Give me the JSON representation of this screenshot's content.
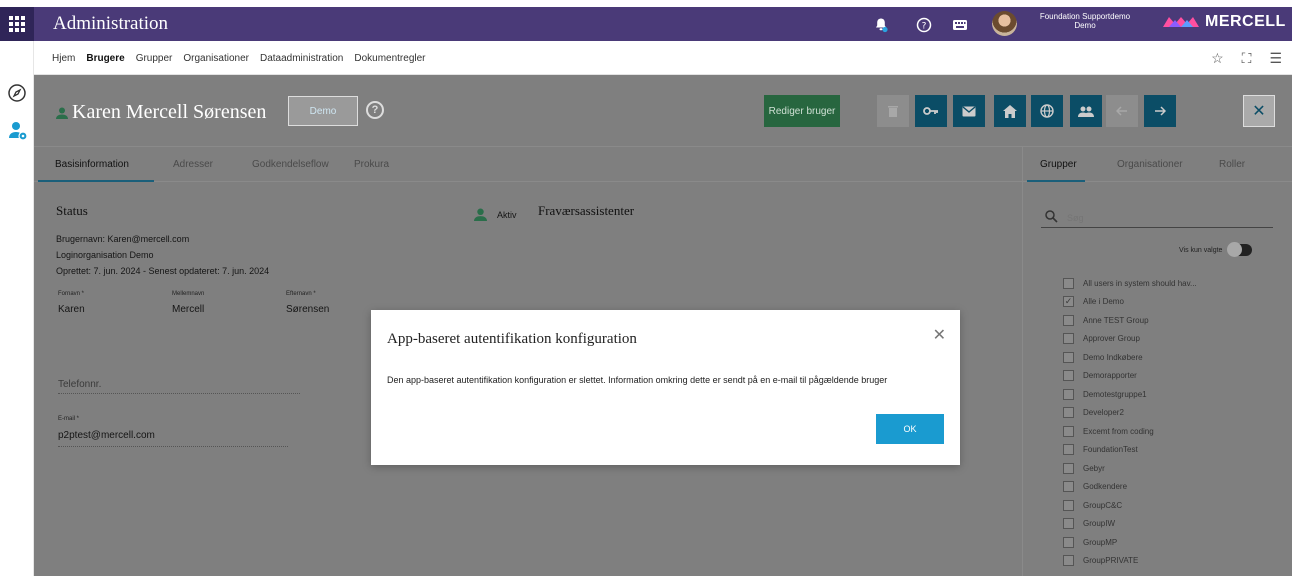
{
  "topbar": {
    "title": "Administration",
    "user_name": "Foundation Supportdemo",
    "user_org": "Demo",
    "brand": "MERCELL"
  },
  "nav": {
    "items": [
      "Hjem",
      "Brugere",
      "Grupper",
      "Organisationer",
      "Dataadministration",
      "Dokumentregler"
    ],
    "active": "Brugere"
  },
  "person": {
    "name": "Karen Mercell Sørensen",
    "org_button": "Demo",
    "help": "?"
  },
  "actions": {
    "edit_label": "Rediger bruger"
  },
  "tabs": [
    "Basisinformation",
    "Adresser",
    "Godkendelseflow",
    "Prokura"
  ],
  "status": {
    "title": "Status",
    "username": "Brugernavn: Karen@mercell.com",
    "login_org": "Loginorganisation Demo",
    "created": "Oprettet: 7. jun. 2024 - Senest opdateret: 7. jun. 2024",
    "aktiv_label": "Aktiv",
    "absence_title": "Fraværsassistenter"
  },
  "fields": {
    "first_name_label": "Fornavn *",
    "first_name": "Karen",
    "middle_name_label": "Mellemnavn",
    "middle_name": "Mercell",
    "last_name_label": "Efternavn *",
    "last_name": "Sørensen",
    "phone_placeholder": "Telefonnr.",
    "email_label": "E-mail *",
    "email": "p2ptest@mercell.com"
  },
  "right_panel": {
    "tabs": [
      "Grupper",
      "Organisationer",
      "Roller"
    ],
    "search_placeholder": "Søg",
    "vis_kun_valgte": "Vis kun valgte",
    "groups": [
      {
        "label": "All users in system should hav...",
        "checked": false
      },
      {
        "label": "Alle i Demo",
        "checked": true
      },
      {
        "label": "Anne TEST Group",
        "checked": false
      },
      {
        "label": "Approver Group",
        "checked": false
      },
      {
        "label": "Demo Indkøbere",
        "checked": false
      },
      {
        "label": "Demorapporter",
        "checked": false
      },
      {
        "label": "Demotestgruppe1",
        "checked": false
      },
      {
        "label": "Developer2",
        "checked": false
      },
      {
        "label": "Excemt from coding",
        "checked": false
      },
      {
        "label": "FoundationTest",
        "checked": false
      },
      {
        "label": "Gebyr",
        "checked": false
      },
      {
        "label": "Godkendere",
        "checked": false
      },
      {
        "label": "GroupC&C",
        "checked": false
      },
      {
        "label": "GroupIW",
        "checked": false
      },
      {
        "label": "GroupMP",
        "checked": false
      },
      {
        "label": "GroupPRIVATE",
        "checked": false
      }
    ]
  },
  "modal": {
    "title": "App-baseret autentifikation konfiguration",
    "message": "Den app-baseret autentifikation konfiguration er slettet. Information omkring dette er sendt på en e-mail til pågældende bruger",
    "ok_label": "OK"
  }
}
